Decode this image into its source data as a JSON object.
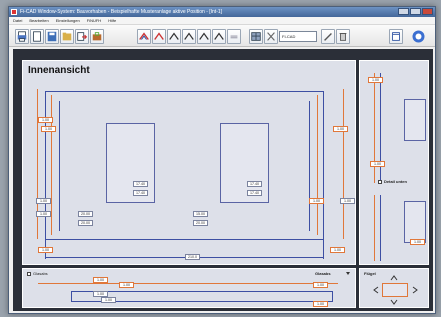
{
  "window": {
    "title": "Fi-CAD Window-System: Bauvorhaben - Beispielhafte Musteranlage  aktive Position - [Int-1]"
  },
  "menu": [
    "Datei",
    "Bearbeiten",
    "Einstellungen",
    "FiNUFH",
    "Hilfe"
  ],
  "toolbar": {
    "field_value": "FI-CAD"
  },
  "main": {
    "title": "Innenansicht",
    "values": {
      "left_top": "1.00",
      "left_mid": "1.00",
      "left_bottom": "1.00",
      "right_top": "1.00",
      "right_mid": "1.00",
      "right_bottom": "1.00",
      "win1_a": "17.40",
      "win1_b": "17.40",
      "win2_a": "17.40",
      "win2_b": "17.40",
      "dim1_a": "20.00",
      "dim1_b": "20.00",
      "dim2_a": "15.00",
      "dim2_b": "20.00",
      "bottom_center": "210.0"
    }
  },
  "right_panel": {
    "detail_label": "Detail unten",
    "values": {
      "top": "1.00",
      "mid": "1.00",
      "bottom": "1.00"
    }
  },
  "bottom_panel": {
    "left_label": "Glasabs",
    "right_label": "Glasabs",
    "values": {
      "a": "1.00",
      "b": "1.00",
      "c": "1.00",
      "d": "1.00",
      "e": "1.00",
      "f": "1.00"
    }
  },
  "bottomright_panel": {
    "label": "Flügel"
  }
}
